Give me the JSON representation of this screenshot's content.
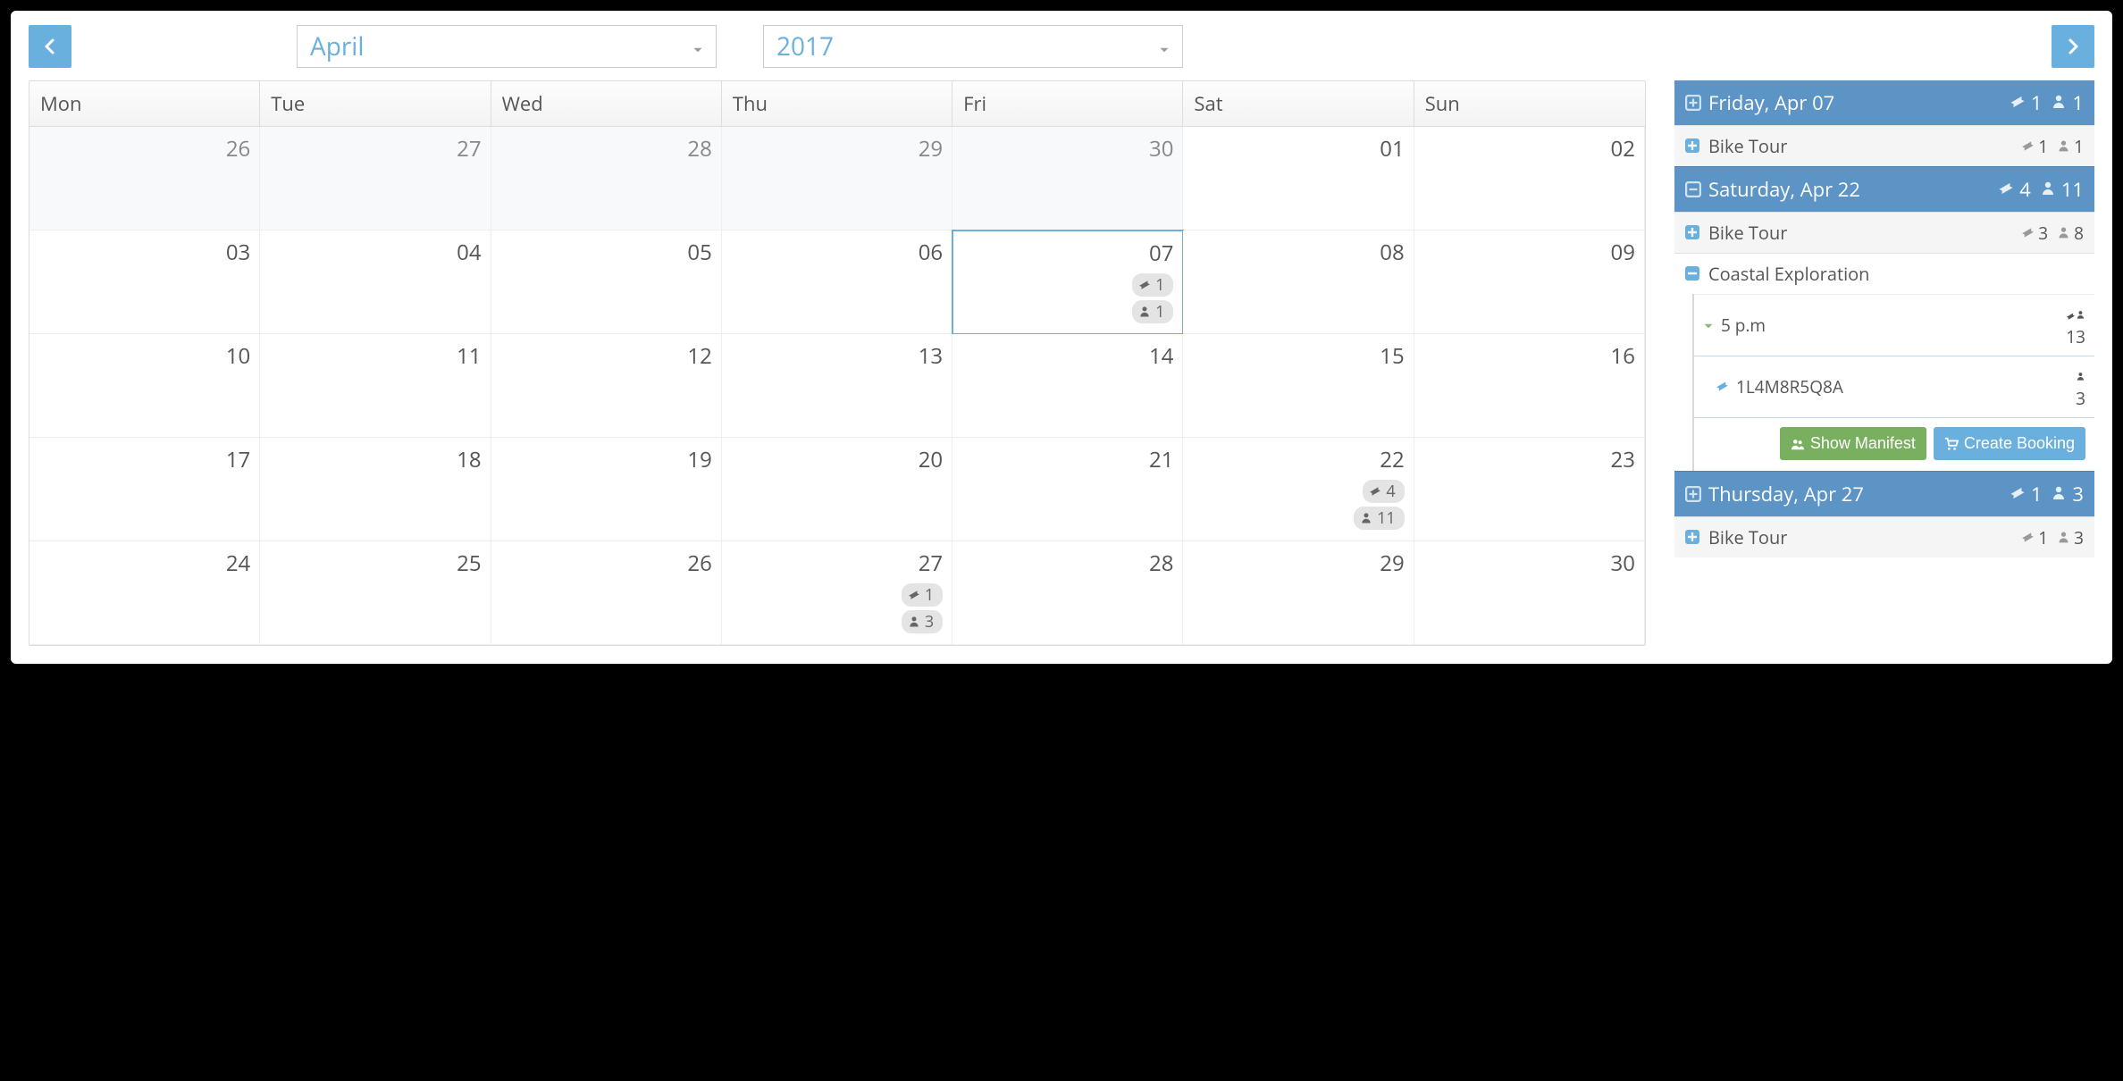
{
  "header": {
    "month": "April",
    "year": "2017"
  },
  "weekdays": [
    "Mon",
    "Tue",
    "Wed",
    "Thu",
    "Fri",
    "Sat",
    "Sun"
  ],
  "cells": [
    {
      "num": "26",
      "out": true
    },
    {
      "num": "27",
      "out": true
    },
    {
      "num": "28",
      "out": true
    },
    {
      "num": "29",
      "out": true
    },
    {
      "num": "30",
      "out": true
    },
    {
      "num": "01"
    },
    {
      "num": "02"
    },
    {
      "num": "03"
    },
    {
      "num": "04"
    },
    {
      "num": "05"
    },
    {
      "num": "06"
    },
    {
      "num": "07",
      "sel": true,
      "tickets": "1",
      "people": "1"
    },
    {
      "num": "08"
    },
    {
      "num": "09"
    },
    {
      "num": "10"
    },
    {
      "num": "11"
    },
    {
      "num": "12"
    },
    {
      "num": "13"
    },
    {
      "num": "14"
    },
    {
      "num": "15"
    },
    {
      "num": "16"
    },
    {
      "num": "17"
    },
    {
      "num": "18"
    },
    {
      "num": "19"
    },
    {
      "num": "20"
    },
    {
      "num": "21"
    },
    {
      "num": "22",
      "tickets": "4",
      "people": "11"
    },
    {
      "num": "23"
    },
    {
      "num": "24"
    },
    {
      "num": "25"
    },
    {
      "num": "26"
    },
    {
      "num": "27",
      "tickets": "1",
      "people": "3"
    },
    {
      "num": "28"
    },
    {
      "num": "29"
    },
    {
      "num": "30"
    }
  ],
  "side": {
    "g1": {
      "title": "Friday, Apr 07",
      "tickets": "1",
      "people": "1",
      "items": [
        {
          "name": "Bike Tour",
          "tickets": "1",
          "people": "1"
        }
      ]
    },
    "g2": {
      "title": "Saturday, Apr 22",
      "tickets": "4",
      "people": "11",
      "item1": {
        "name": "Bike Tour",
        "tickets": "3",
        "people": "8"
      },
      "item2": {
        "name": "Coastal Exploration",
        "time": {
          "label": "5 p.m",
          "tickets": "1",
          "people": "3"
        },
        "code": {
          "value": "1L4M8R5Q8A",
          "people": "3"
        },
        "actions": {
          "manifest": "Show Manifest",
          "booking": "Create Booking"
        }
      }
    },
    "g3": {
      "title": "Thursday, Apr 27",
      "tickets": "1",
      "people": "3",
      "items": [
        {
          "name": "Bike Tour",
          "tickets": "1",
          "people": "3"
        }
      ]
    }
  }
}
